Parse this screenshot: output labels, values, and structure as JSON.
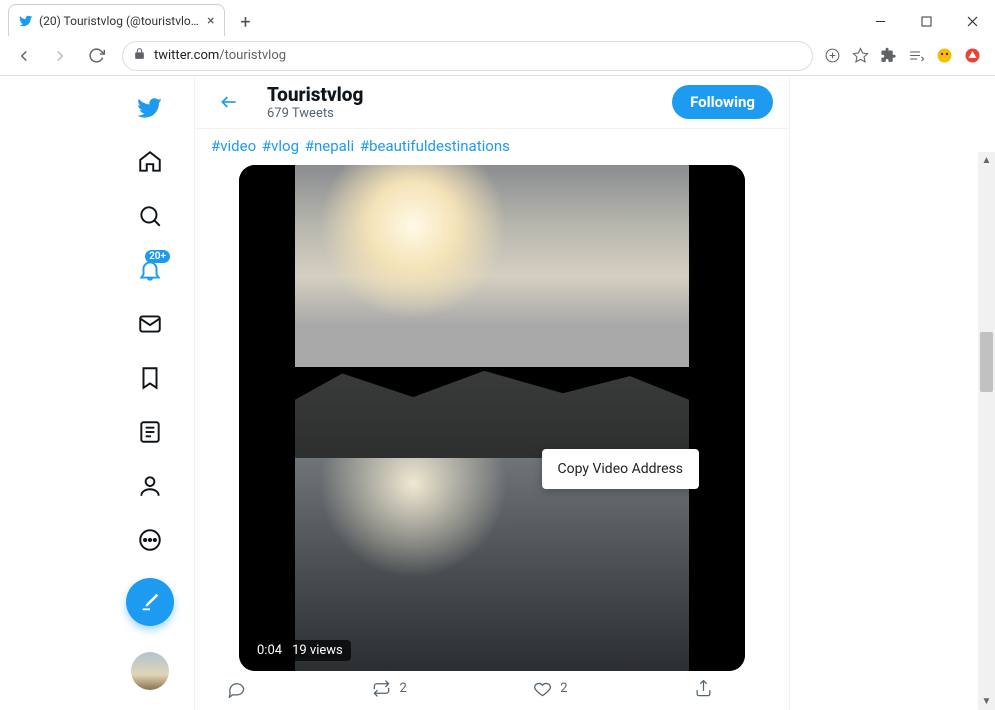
{
  "browser": {
    "tab_title": "(20) Touristvlog (@touristvlog) / T",
    "url_domain": "twitter.com",
    "url_path": "/touristvlog"
  },
  "sidebar": {
    "notification_badge": "20+"
  },
  "header": {
    "name": "Touristvlog",
    "tweets_sub": "679 Tweets",
    "follow_button": "Following"
  },
  "tweet": {
    "hashtags": [
      "#video",
      "#vlog",
      "#nepali",
      "#beautifuldestinations"
    ],
    "video": {
      "time": "0:04",
      "views": "19 views"
    },
    "context_menu_item": "Copy Video Address",
    "retweet_count": "2",
    "like_count": "2"
  }
}
